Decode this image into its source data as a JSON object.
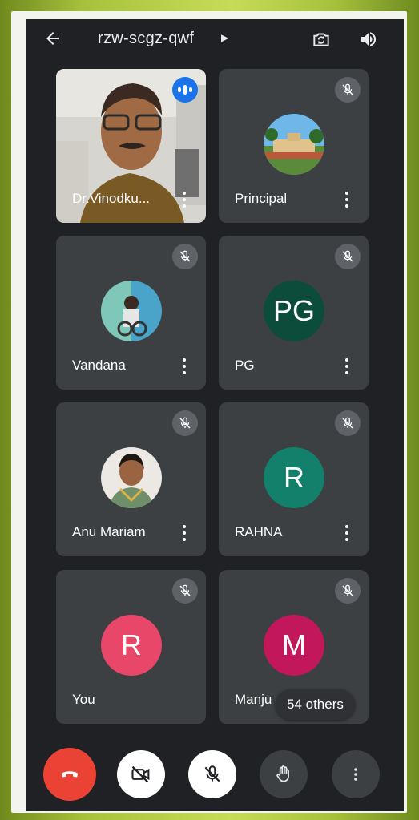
{
  "header": {
    "meeting_code": "rzw-scgz-qwf"
  },
  "participants": [
    {
      "name": "Dr.Vinodku...",
      "state": "speaking",
      "type": "video"
    },
    {
      "name": "Principal",
      "state": "muted",
      "type": "photo"
    },
    {
      "name": "Vandana",
      "state": "muted",
      "type": "photo"
    },
    {
      "name": "PG",
      "initials": "PG",
      "state": "muted",
      "avatar_color": "#0b4d3a"
    },
    {
      "name": "Anu Mariam",
      "state": "muted",
      "type": "photo"
    },
    {
      "name": "RAHNA",
      "initials": "R",
      "state": "muted",
      "avatar_color": "#12806a"
    },
    {
      "name": "You",
      "initials": "R",
      "state": "muted",
      "avatar_color": "#e8476a"
    },
    {
      "name": "Manju",
      "initials": "M",
      "state": "muted",
      "avatar_color": "#c2185b"
    }
  ],
  "others_label": "54 others",
  "controls": [
    {
      "icon": "end-call-icon",
      "color": "#ea4335"
    },
    {
      "icon": "camera-off-icon",
      "color": "#ffffff"
    },
    {
      "icon": "mic-off-icon",
      "color": "#ffffff"
    },
    {
      "icon": "raise-hand-icon",
      "color": "#3c4043"
    },
    {
      "icon": "more-options-icon",
      "color": "#3c4043"
    }
  ]
}
